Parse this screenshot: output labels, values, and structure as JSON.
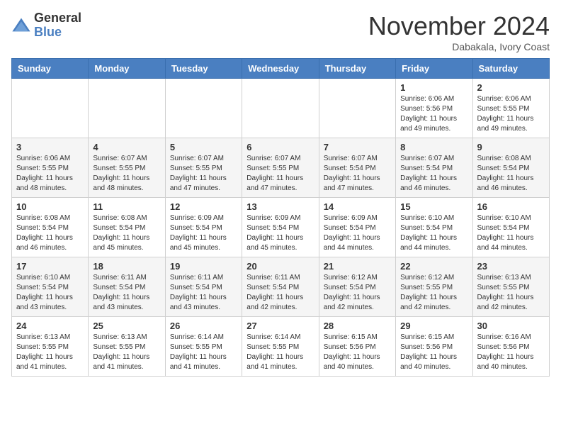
{
  "logo": {
    "general": "General",
    "blue": "Blue"
  },
  "title": "November 2024",
  "location": "Dabakala, Ivory Coast",
  "days_of_week": [
    "Sunday",
    "Monday",
    "Tuesday",
    "Wednesday",
    "Thursday",
    "Friday",
    "Saturday"
  ],
  "weeks": [
    [
      {
        "day": "",
        "info": ""
      },
      {
        "day": "",
        "info": ""
      },
      {
        "day": "",
        "info": ""
      },
      {
        "day": "",
        "info": ""
      },
      {
        "day": "",
        "info": ""
      },
      {
        "day": "1",
        "info": "Sunrise: 6:06 AM\nSunset: 5:56 PM\nDaylight: 11 hours\nand 49 minutes."
      },
      {
        "day": "2",
        "info": "Sunrise: 6:06 AM\nSunset: 5:55 PM\nDaylight: 11 hours\nand 49 minutes."
      }
    ],
    [
      {
        "day": "3",
        "info": "Sunrise: 6:06 AM\nSunset: 5:55 PM\nDaylight: 11 hours\nand 48 minutes."
      },
      {
        "day": "4",
        "info": "Sunrise: 6:07 AM\nSunset: 5:55 PM\nDaylight: 11 hours\nand 48 minutes."
      },
      {
        "day": "5",
        "info": "Sunrise: 6:07 AM\nSunset: 5:55 PM\nDaylight: 11 hours\nand 47 minutes."
      },
      {
        "day": "6",
        "info": "Sunrise: 6:07 AM\nSunset: 5:55 PM\nDaylight: 11 hours\nand 47 minutes."
      },
      {
        "day": "7",
        "info": "Sunrise: 6:07 AM\nSunset: 5:54 PM\nDaylight: 11 hours\nand 47 minutes."
      },
      {
        "day": "8",
        "info": "Sunrise: 6:07 AM\nSunset: 5:54 PM\nDaylight: 11 hours\nand 46 minutes."
      },
      {
        "day": "9",
        "info": "Sunrise: 6:08 AM\nSunset: 5:54 PM\nDaylight: 11 hours\nand 46 minutes."
      }
    ],
    [
      {
        "day": "10",
        "info": "Sunrise: 6:08 AM\nSunset: 5:54 PM\nDaylight: 11 hours\nand 46 minutes."
      },
      {
        "day": "11",
        "info": "Sunrise: 6:08 AM\nSunset: 5:54 PM\nDaylight: 11 hours\nand 45 minutes."
      },
      {
        "day": "12",
        "info": "Sunrise: 6:09 AM\nSunset: 5:54 PM\nDaylight: 11 hours\nand 45 minutes."
      },
      {
        "day": "13",
        "info": "Sunrise: 6:09 AM\nSunset: 5:54 PM\nDaylight: 11 hours\nand 45 minutes."
      },
      {
        "day": "14",
        "info": "Sunrise: 6:09 AM\nSunset: 5:54 PM\nDaylight: 11 hours\nand 44 minutes."
      },
      {
        "day": "15",
        "info": "Sunrise: 6:10 AM\nSunset: 5:54 PM\nDaylight: 11 hours\nand 44 minutes."
      },
      {
        "day": "16",
        "info": "Sunrise: 6:10 AM\nSunset: 5:54 PM\nDaylight: 11 hours\nand 44 minutes."
      }
    ],
    [
      {
        "day": "17",
        "info": "Sunrise: 6:10 AM\nSunset: 5:54 PM\nDaylight: 11 hours\nand 43 minutes."
      },
      {
        "day": "18",
        "info": "Sunrise: 6:11 AM\nSunset: 5:54 PM\nDaylight: 11 hours\nand 43 minutes."
      },
      {
        "day": "19",
        "info": "Sunrise: 6:11 AM\nSunset: 5:54 PM\nDaylight: 11 hours\nand 43 minutes."
      },
      {
        "day": "20",
        "info": "Sunrise: 6:11 AM\nSunset: 5:54 PM\nDaylight: 11 hours\nand 42 minutes."
      },
      {
        "day": "21",
        "info": "Sunrise: 6:12 AM\nSunset: 5:54 PM\nDaylight: 11 hours\nand 42 minutes."
      },
      {
        "day": "22",
        "info": "Sunrise: 6:12 AM\nSunset: 5:55 PM\nDaylight: 11 hours\nand 42 minutes."
      },
      {
        "day": "23",
        "info": "Sunrise: 6:13 AM\nSunset: 5:55 PM\nDaylight: 11 hours\nand 42 minutes."
      }
    ],
    [
      {
        "day": "24",
        "info": "Sunrise: 6:13 AM\nSunset: 5:55 PM\nDaylight: 11 hours\nand 41 minutes."
      },
      {
        "day": "25",
        "info": "Sunrise: 6:13 AM\nSunset: 5:55 PM\nDaylight: 11 hours\nand 41 minutes."
      },
      {
        "day": "26",
        "info": "Sunrise: 6:14 AM\nSunset: 5:55 PM\nDaylight: 11 hours\nand 41 minutes."
      },
      {
        "day": "27",
        "info": "Sunrise: 6:14 AM\nSunset: 5:55 PM\nDaylight: 11 hours\nand 41 minutes."
      },
      {
        "day": "28",
        "info": "Sunrise: 6:15 AM\nSunset: 5:56 PM\nDaylight: 11 hours\nand 40 minutes."
      },
      {
        "day": "29",
        "info": "Sunrise: 6:15 AM\nSunset: 5:56 PM\nDaylight: 11 hours\nand 40 minutes."
      },
      {
        "day": "30",
        "info": "Sunrise: 6:16 AM\nSunset: 5:56 PM\nDaylight: 11 hours\nand 40 minutes."
      }
    ]
  ]
}
